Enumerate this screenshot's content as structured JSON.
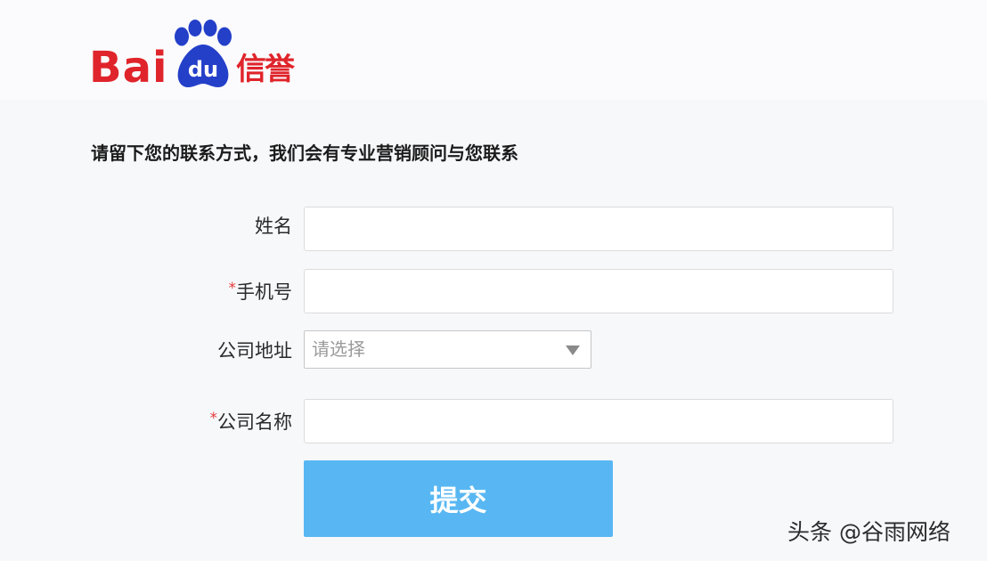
{
  "logo": {
    "text_bai": "Bai",
    "text_du": "du",
    "text_suffix": "信誉",
    "brand_red": "#e0242b",
    "brand_blue": "#2440c9"
  },
  "intro": "请留下您的联系方式，我们会有专业营销顾问与您联系",
  "form": {
    "required_mark": "*",
    "name": {
      "label": "姓名",
      "value": ""
    },
    "phone": {
      "label": "手机号",
      "value": ""
    },
    "address": {
      "label": "公司地址",
      "placeholder": "请选择"
    },
    "company": {
      "label": "公司名称",
      "value": ""
    },
    "submit_label": "提交",
    "accent": "#58b7f3"
  },
  "watermark": "头条 @谷雨网络"
}
